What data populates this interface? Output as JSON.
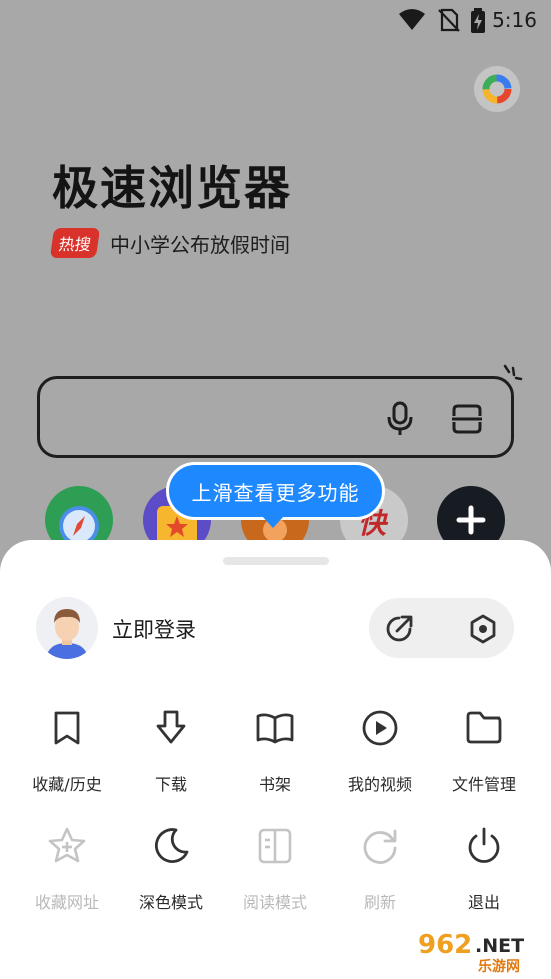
{
  "status_bar": {
    "time": "5:16",
    "icons": [
      "wifi-icon",
      "no-sim-icon",
      "battery-charging-icon"
    ]
  },
  "header": {
    "brand": "极速浏览器",
    "hot_badge": "热搜",
    "hot_text": "中小学公布放假时间"
  },
  "search": {
    "icons": [
      "microphone-icon",
      "scan-icon"
    ]
  },
  "quick_links": [
    {
      "name": "compass",
      "icon": "compass-icon",
      "color": "#2f9e55"
    },
    {
      "name": "star-app",
      "icon": "star-icon",
      "color": "#5d4cc8"
    },
    {
      "name": "orange-app",
      "icon": "app-icon",
      "color": "#c7681d"
    },
    {
      "name": "kuai-app",
      "icon": "kuai-icon",
      "text": "快",
      "color": "#b7b7b7"
    },
    {
      "name": "add",
      "icon": "plus-icon",
      "color": "#171b22"
    }
  ],
  "tooltip": {
    "text": "上滑查看更多功能"
  },
  "account": {
    "login_label": "立即登录",
    "actions": [
      "share-icon",
      "settings-icon"
    ]
  },
  "menu": {
    "row1": [
      {
        "label": "收藏/历史",
        "icon": "bookmark-icon",
        "enabled": true
      },
      {
        "label": "下载",
        "icon": "download-icon",
        "enabled": true
      },
      {
        "label": "书架",
        "icon": "book-icon",
        "enabled": true
      },
      {
        "label": "我的视频",
        "icon": "play-icon",
        "enabled": true
      },
      {
        "label": "文件管理",
        "icon": "folder-icon",
        "enabled": true
      }
    ],
    "row2": [
      {
        "label": "收藏网址",
        "icon": "star-add-icon",
        "enabled": false
      },
      {
        "label": "深色模式",
        "icon": "moon-icon",
        "enabled": true
      },
      {
        "label": "阅读模式",
        "icon": "reader-icon",
        "enabled": false
      },
      {
        "label": "刷新",
        "icon": "refresh-icon",
        "enabled": false
      },
      {
        "label": "退出",
        "icon": "power-icon",
        "enabled": true
      }
    ]
  },
  "watermark": {
    "brand": "962",
    "net": ".NET",
    "site": "乐游网"
  },
  "colors": {
    "accent": "#1e88ff",
    "hot": "#d8322a",
    "sheet": "#ffffff",
    "overlay": "#a8a8a8"
  }
}
